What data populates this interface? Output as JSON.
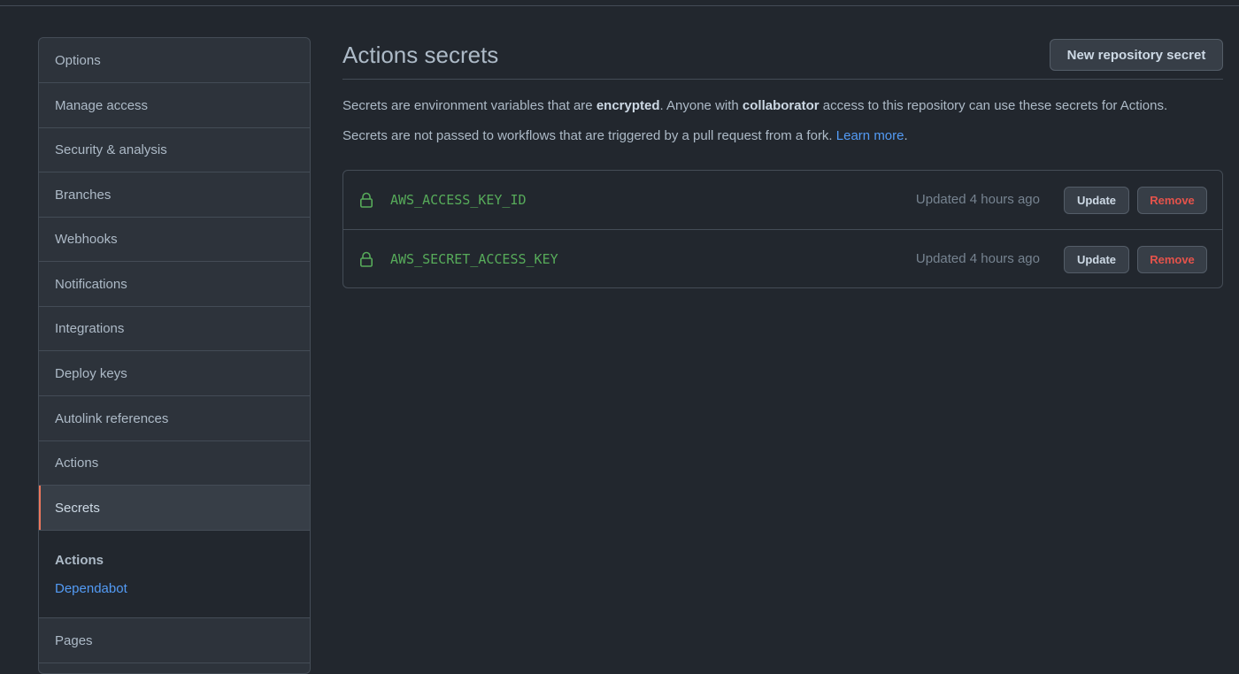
{
  "sidebar": {
    "items": [
      {
        "label": "Options"
      },
      {
        "label": "Manage access"
      },
      {
        "label": "Security & analysis"
      },
      {
        "label": "Branches"
      },
      {
        "label": "Webhooks"
      },
      {
        "label": "Notifications"
      },
      {
        "label": "Integrations"
      },
      {
        "label": "Deploy keys"
      },
      {
        "label": "Autolink references"
      },
      {
        "label": "Actions"
      },
      {
        "label": "Secrets",
        "selected": true
      }
    ],
    "subsection": {
      "heading": "Actions",
      "link": "Dependabot"
    },
    "after": [
      {
        "label": "Pages"
      }
    ]
  },
  "main": {
    "title": "Actions secrets",
    "new_button": "New repository secret",
    "desc1": {
      "part1": "Secrets are environment variables that are ",
      "bold1": "encrypted",
      "part2": ". Anyone with ",
      "bold2": "collaborator",
      "part3": " access to this repository can use these secrets for Actions."
    },
    "desc2": {
      "text": "Secrets are not passed to workflows that are triggered by a pull request from a fork. ",
      "link": "Learn more",
      "end": "."
    },
    "secrets": [
      {
        "icon": "lock-icon",
        "name": "AWS_ACCESS_KEY_ID",
        "updated": "Updated 4 hours ago",
        "update_label": "Update",
        "remove_label": "Remove"
      },
      {
        "icon": "lock-icon",
        "name": "AWS_SECRET_ACCESS_KEY",
        "updated": "Updated 4 hours ago",
        "update_label": "Update",
        "remove_label": "Remove"
      }
    ]
  },
  "colors": {
    "background": "#22272e",
    "selected_accent": "#ec775c",
    "link": "#539bf5",
    "secret_name": "#57ab5a",
    "danger": "#e5534b"
  }
}
